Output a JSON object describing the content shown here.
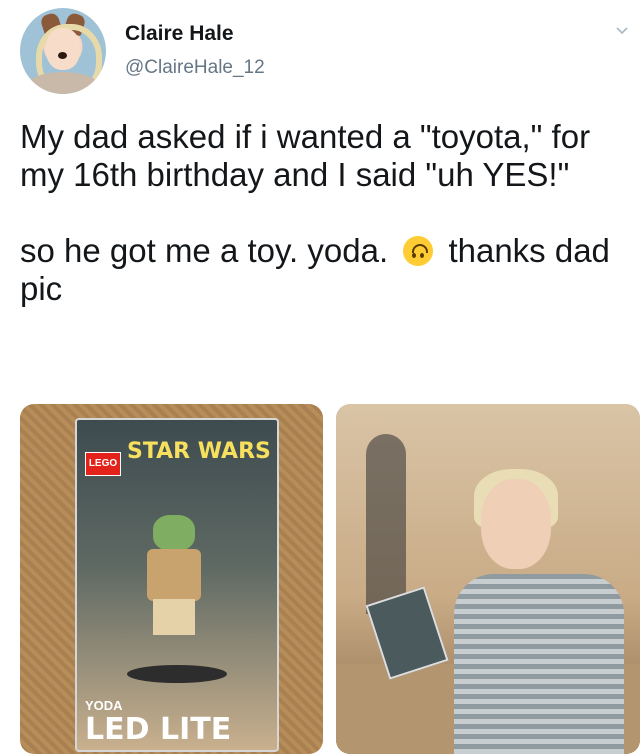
{
  "author": {
    "name": "Claire Hale",
    "handle": "@ClaireHale_12"
  },
  "tweet": {
    "line1": "My dad asked if i wanted a \"toyota,\" for my 16th birthday and I said \"uh YES!\"",
    "line2_before": "so he got me a toy. yoda.",
    "line2_after": "thanks dad pic",
    "emoji": "upside-down-face-emoji"
  },
  "photos": {
    "left": {
      "brand": "LEGO",
      "series": "STAR WARS",
      "character": "YODA",
      "product": "LED LITE"
    }
  },
  "icons": {
    "menu": "chevron-down-icon"
  }
}
